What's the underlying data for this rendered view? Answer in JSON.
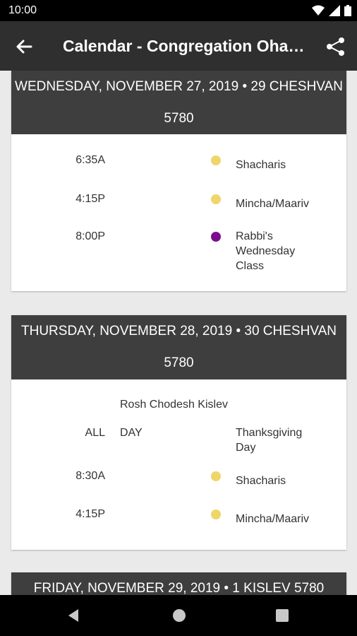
{
  "status": {
    "time": "10:00"
  },
  "appbar": {
    "title": "Calendar - Congregation Ohav Sholom"
  },
  "colors": {
    "dot_yellow": "#f0d56a",
    "dot_purple": "#7b0e8e",
    "header_bg": "#3e3e3e",
    "appbar_bg": "#2f2f2f"
  },
  "days": [
    {
      "header_line1": "WEDNESDAY, NOVEMBER 27, 2019  •  29 CHESHVAN",
      "header_line2": "5780",
      "events": [
        {
          "time": "6:35A",
          "color": "yellow",
          "title": "Shacharis"
        },
        {
          "time": "4:15P",
          "color": "yellow",
          "title": "Mincha/Maariv"
        },
        {
          "time": "8:00P",
          "color": "purple",
          "title": "Rabbi's Wednesday Class"
        }
      ]
    },
    {
      "header_line1": "THURSDAY, NOVEMBER 28, 2019  •  30 CHESHVAN",
      "header_line2": "5780",
      "note": "Rosh Chodesh Kislev",
      "allday": {
        "label_all": "ALL",
        "label_day": "DAY",
        "title": "Thanksgiving Day"
      },
      "events": [
        {
          "time": "8:30A",
          "color": "yellow",
          "title": "Shacharis"
        },
        {
          "time": "4:15P",
          "color": "yellow",
          "title": "Mincha/Maariv"
        }
      ]
    },
    {
      "header_line1": "FRIDAY, NOVEMBER 29, 2019  •  1 KISLEV 5780"
    }
  ]
}
